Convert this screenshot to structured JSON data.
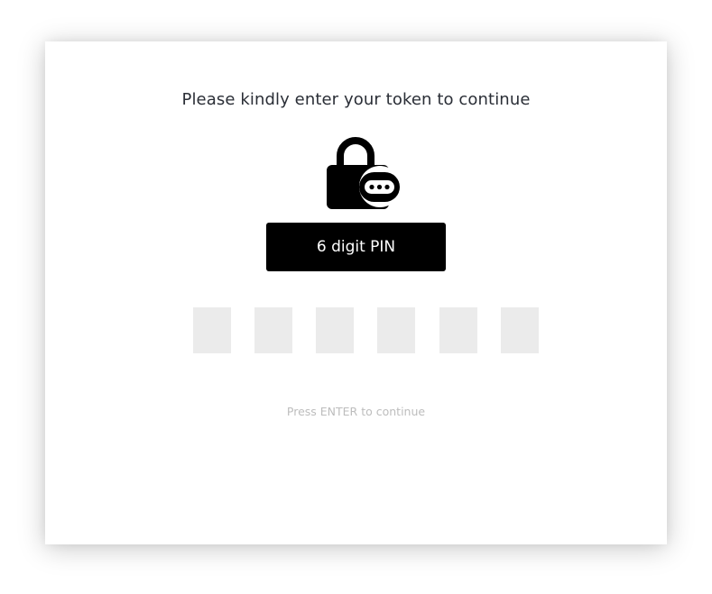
{
  "prompt": {
    "title": "Please kindly enter your token to continue"
  },
  "icons": {
    "lock": "lock-with-password-icon"
  },
  "pin_button": {
    "label": "6 digit PIN"
  },
  "pin_inputs": [
    {
      "value": ""
    },
    {
      "value": ""
    },
    {
      "value": ""
    },
    {
      "value": ""
    },
    {
      "value": ""
    },
    {
      "value": ""
    }
  ],
  "hint": {
    "text": "Press ENTER to continue"
  },
  "colors": {
    "accent": "#000000",
    "pin_box_bg": "#ebebeb",
    "hint_text": "#bdbdbd",
    "title_text": "#2a2e36"
  }
}
